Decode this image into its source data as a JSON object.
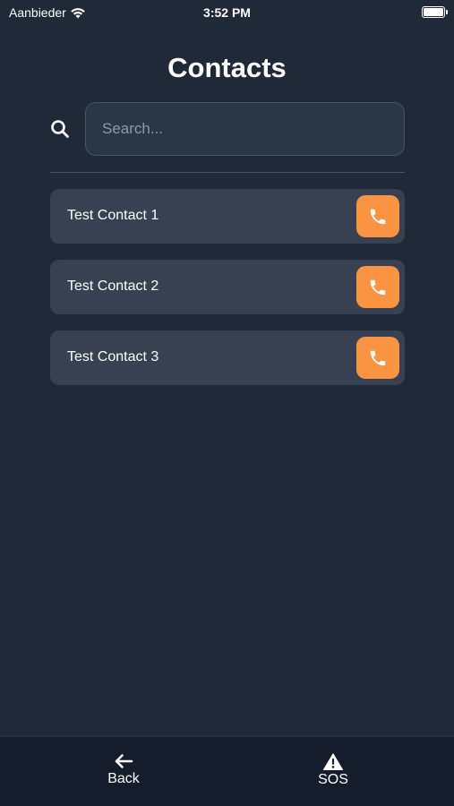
{
  "status_bar": {
    "carrier": "Aanbieder",
    "time": "3:52 PM"
  },
  "header": {
    "title": "Contacts"
  },
  "search": {
    "placeholder": "Search...",
    "value": ""
  },
  "contacts": [
    {
      "name": "Test Contact 1",
      "action_icon": "phone-icon"
    },
    {
      "name": "Test Contact 2",
      "action_icon": "phone-icon"
    },
    {
      "name": "Test Contact 3",
      "action_icon": "phone-icon"
    }
  ],
  "tab_bar": {
    "back": {
      "label": "Back",
      "icon": "arrow-left-icon"
    },
    "sos": {
      "label": "SOS",
      "icon": "warning-triangle-icon"
    }
  },
  "colors": {
    "background": "#1f2937",
    "card": "#374151",
    "accent": "#fa9442",
    "tab_bar": "#151c2c"
  }
}
